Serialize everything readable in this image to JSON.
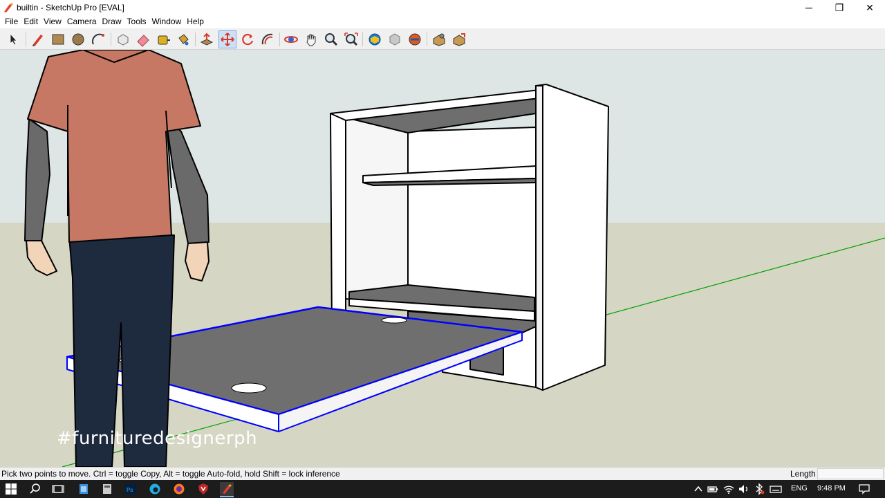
{
  "window": {
    "title": "builtin - SketchUp Pro [EVAL]",
    "controls": {
      "minimize": "─",
      "restore": "❐",
      "close": "✕"
    }
  },
  "menu": {
    "items": [
      "File",
      "Edit",
      "View",
      "Camera",
      "Draw",
      "Tools",
      "Window",
      "Help"
    ]
  },
  "toolbar": {
    "tools": [
      {
        "name": "select-tool",
        "icon": "arrow-cursor-icon"
      },
      {
        "name": "line-tool",
        "icon": "pencil-icon"
      },
      {
        "name": "rectangle-tool",
        "icon": "rectangle-icon"
      },
      {
        "name": "circle-tool",
        "icon": "circle-icon"
      },
      {
        "name": "arc-tool",
        "icon": "arc-icon"
      },
      {
        "name": "make-component-tool",
        "icon": "component-icon"
      },
      {
        "name": "eraser-tool",
        "icon": "eraser-icon"
      },
      {
        "name": "tape-measure-tool",
        "icon": "tape-measure-icon"
      },
      {
        "name": "paint-bucket-tool",
        "icon": "paint-bucket-icon"
      },
      {
        "name": "push-pull-tool",
        "icon": "push-pull-icon"
      },
      {
        "name": "move-tool",
        "icon": "move-icon",
        "active": true
      },
      {
        "name": "rotate-tool",
        "icon": "rotate-icon"
      },
      {
        "name": "offset-tool",
        "icon": "offset-icon"
      },
      {
        "name": "orbit-tool",
        "icon": "orbit-icon"
      },
      {
        "name": "pan-tool",
        "icon": "hand-icon"
      },
      {
        "name": "zoom-tool",
        "icon": "magnifier-icon"
      },
      {
        "name": "zoom-extents-tool",
        "icon": "zoom-extents-icon"
      },
      {
        "name": "3d-warehouse-tool",
        "icon": "warehouse-globe-icon"
      },
      {
        "name": "extension-warehouse-tool",
        "icon": "extension-icon"
      },
      {
        "name": "trimble-connect-tool",
        "icon": "connect-icon"
      },
      {
        "name": "extension-manager-tool",
        "icon": "extension-manager-icon"
      },
      {
        "name": "layout-tool",
        "icon": "layout-icon"
      }
    ]
  },
  "viewport": {
    "watermark": "#furnituredesignerph",
    "colors": {
      "sky": "#dfe6e6",
      "ground": "#d6d6c4",
      "selection": "#0000ff",
      "green_axis": "#00a000"
    }
  },
  "status": {
    "hint": "Pick two points to move.  Ctrl = toggle Copy, Alt = toggle Auto-fold, hold Shift = lock inference",
    "measurement_label": "Length",
    "measurement_value": ""
  },
  "taskbar": {
    "language": "ENG",
    "time": "9:48 PM"
  }
}
